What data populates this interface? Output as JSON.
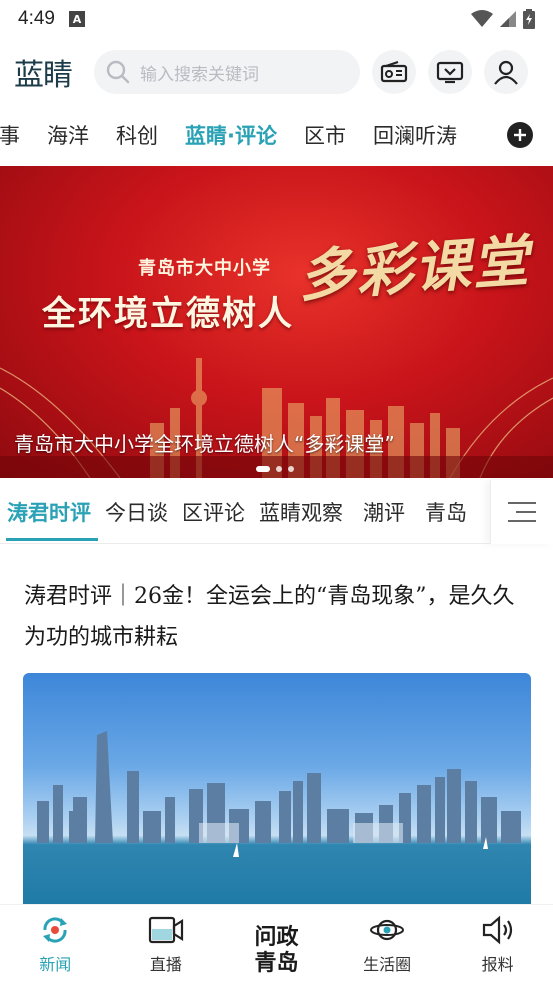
{
  "status_bar": {
    "time": "4:49",
    "notification_letter": "A"
  },
  "header": {
    "logo": "蓝睛",
    "search_placeholder": "输入搜索关键词"
  },
  "channels": {
    "items": [
      "故事",
      "海洋",
      "科创",
      "蓝睛·评论",
      "区市",
      "回澜听涛"
    ],
    "active_index": 3
  },
  "banner": {
    "subtitle": "青岛市大中小学",
    "headline": "全环境立德树人",
    "art_text": "多彩课堂",
    "caption": "青岛市大中小学全环境立德树人“多彩课堂”",
    "slide_count": 3,
    "active_slide": 0
  },
  "subtabs": {
    "items": [
      "涛君时评",
      "今日谈",
      "区评论",
      "蓝睛观察",
      "潮评",
      "青岛"
    ],
    "active_index": 0
  },
  "article": {
    "title": "涛君时评｜26金！全运会上的“青岛现象”，是久久为功的城市耕耘"
  },
  "bottom_nav": {
    "items": [
      {
        "label": "新闻",
        "icon": "news-refresh-icon",
        "active": true
      },
      {
        "label": "直播",
        "icon": "video-camera-icon",
        "active": false
      },
      {
        "label": "问政青岛",
        "line1": "问政",
        "line2": "青岛",
        "active": false
      },
      {
        "label": "生活圈",
        "icon": "planet-icon",
        "active": false
      },
      {
        "label": "报料",
        "icon": "speaker-icon",
        "active": false
      }
    ]
  },
  "colors": {
    "accent": "#2aa2b6",
    "banner_red": "#c8141a"
  }
}
